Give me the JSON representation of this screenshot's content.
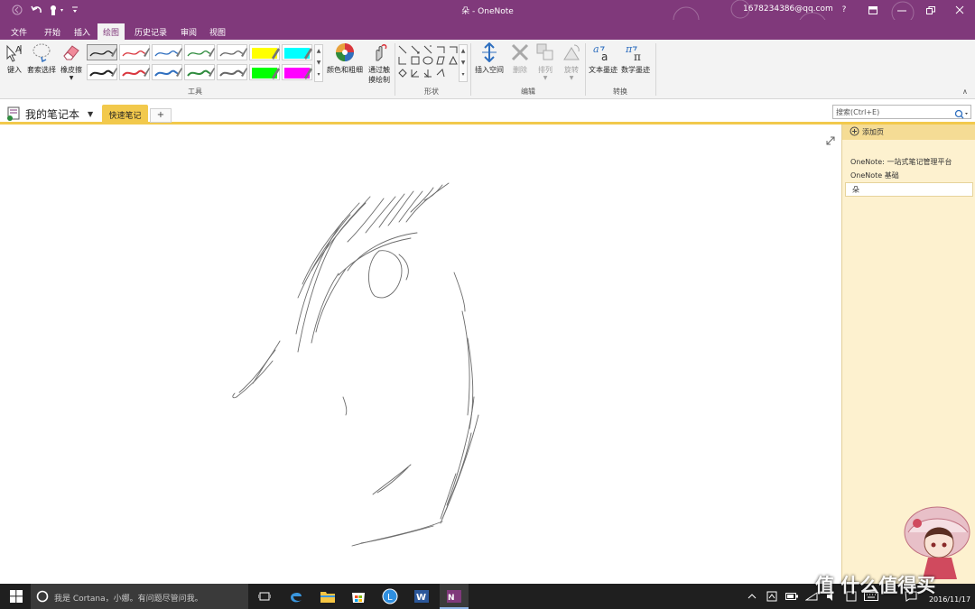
{
  "window": {
    "title": "朵 - OneNote",
    "account": "1678234386@qq.com",
    "help": "?",
    "accent": "#80397b"
  },
  "menu": {
    "tabs": [
      "文件",
      "开始",
      "插入",
      "绘图",
      "历史记录",
      "审阅",
      "视图"
    ],
    "active": "绘图"
  },
  "ribbon": {
    "type_label": "键入",
    "lasso_label": "套索选择",
    "eraser_label": "橡皮擦",
    "color_thickness_label": "颜色和粗细",
    "touch_draw_label": "通过触摸绘制",
    "insert_space_label": "插入空间",
    "delete_label": "删除",
    "arrange_label": "排列",
    "rotate_label": "旋转",
    "ink_to_text_label": "文本墨迹",
    "ink_to_math_label": "数学墨迹",
    "groups": {
      "tools": "工具",
      "shapes": "形状",
      "edit": "编辑",
      "convert": "转换"
    },
    "pen_colors": [
      "#222222",
      "#d9363e",
      "#2f6fbf",
      "#2e8b3d",
      "#666666",
      "#ffff00",
      "#00ffff",
      "#222222",
      "#d9363e",
      "#2f6fbf",
      "#2e8b3d",
      "#666666",
      "#00ff00",
      "#ff00ff"
    ]
  },
  "notebook": {
    "name": "我的笔记本",
    "section_tab": "快速笔记",
    "add_tab": "+",
    "search_placeholder": "搜索(Ctrl+E)"
  },
  "pages": {
    "add_page": "添加页",
    "items": [
      "OneNote: 一站式笔记管理平台",
      "OneNote 基础"
    ],
    "selected": "朵"
  },
  "taskbar": {
    "cortana": "我是 Cortana，小娜。有问题尽管问我。",
    "time": "",
    "date": "2016/11/17",
    "watermark": "值 什么值得买"
  }
}
